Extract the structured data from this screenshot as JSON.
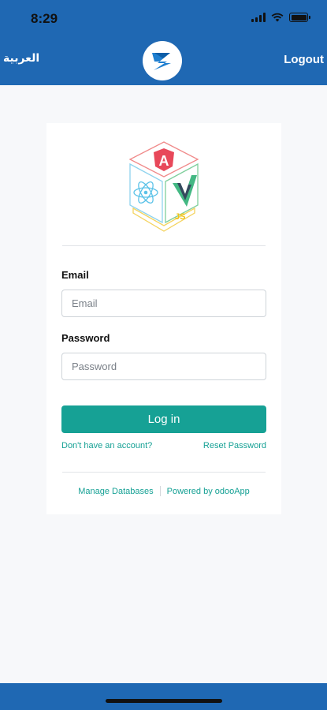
{
  "status_bar": {
    "time": "8:29"
  },
  "header": {
    "language_label": "العربية",
    "logout_label": "Logout",
    "brand_color": "#1f68b3"
  },
  "login_card": {
    "email_label": "Email",
    "email_placeholder": "Email",
    "email_value": "",
    "password_label": "Password",
    "password_placeholder": "Password",
    "password_value": "",
    "login_button_label": "Log in",
    "signup_link": "Don't have an account?",
    "reset_link": "Reset Password",
    "accent_color": "#16a195"
  },
  "footer": {
    "manage_databases": "Manage Databases",
    "powered_by": "Powered by odooApp"
  },
  "icons": {
    "logo": "framework-cube-logo",
    "brand": "brand-s-logo"
  }
}
